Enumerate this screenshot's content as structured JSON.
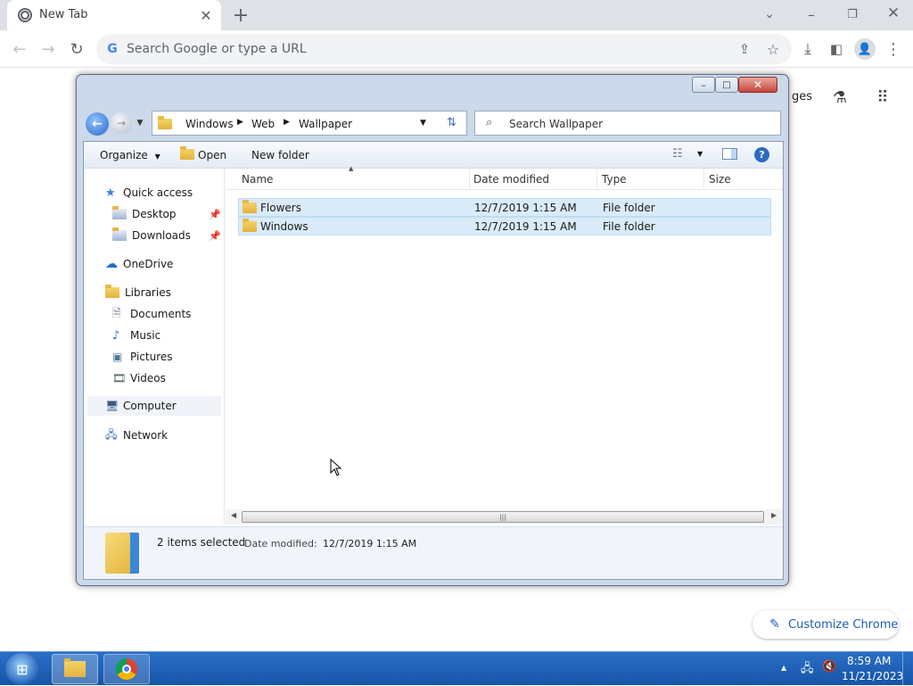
{
  "browser": {
    "tab_title": "New Tab",
    "omnibox_placeholder": "Search Google or type a URL",
    "partial_link": "ges",
    "customize_label": "Customize Chrome"
  },
  "dialog": {
    "breadcrumb": [
      "Windows",
      "Web",
      "Wallpaper"
    ],
    "search_placeholder": "Search Wallpaper",
    "commands": {
      "organize": "Organize",
      "open": "Open",
      "new_folder": "New folder"
    },
    "nav": [
      {
        "label": "Quick access",
        "icon": "star-icon"
      },
      {
        "label": "Desktop",
        "icon": "folder-icon",
        "pinned": true
      },
      {
        "label": "Downloads",
        "icon": "folder-icon",
        "pinned": true
      },
      {
        "label": "OneDrive",
        "icon": "cloud-icon"
      },
      {
        "label": "Libraries",
        "icon": "library-icon"
      },
      {
        "label": "Documents",
        "icon": "document-icon"
      },
      {
        "label": "Music",
        "icon": "music-icon"
      },
      {
        "label": "Pictures",
        "icon": "picture-icon"
      },
      {
        "label": "Videos",
        "icon": "video-icon"
      },
      {
        "label": "Computer",
        "icon": "computer-icon"
      },
      {
        "label": "Network",
        "icon": "network-icon"
      }
    ],
    "columns": [
      "Name",
      "Date modified",
      "Type",
      "Size"
    ],
    "files": [
      {
        "name": "Flowers",
        "date": "12/7/2019 1:15 AM",
        "type": "File folder",
        "size": ""
      },
      {
        "name": "Windows",
        "date": "12/7/2019 1:15 AM",
        "type": "File folder",
        "size": ""
      }
    ],
    "details": {
      "selection": "2 items selected",
      "date_label": "Date modified:",
      "date_value": "12/7/2019 1:15 AM"
    }
  },
  "taskbar": {
    "time": "8:59 AM",
    "date": "11/21/2023"
  }
}
